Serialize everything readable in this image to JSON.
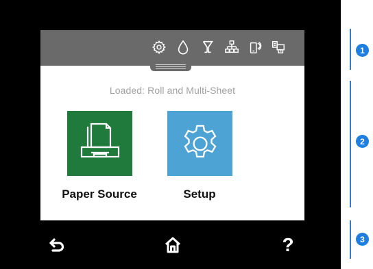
{
  "status_bar": {
    "icons": [
      "settings-icon",
      "ink-drop-icon",
      "wifi-direct-icon",
      "network-icon",
      "mobile-print-icon",
      "printer-info-icon"
    ]
  },
  "screen": {
    "loaded_text": "Loaded: Roll and Multi-Sheet"
  },
  "apps": [
    {
      "label": "Paper Source",
      "icon": "paper-source-icon",
      "color": "#1f7a3c"
    },
    {
      "label": "Setup",
      "icon": "gear-icon",
      "color": "#4da3d3"
    }
  ],
  "nav": {
    "back_icon": "back-icon",
    "home_icon": "home-icon",
    "help_label": "?"
  },
  "callouts": [
    "1",
    "2",
    "3"
  ],
  "colors": {
    "status_bar": "#6a6a6a",
    "callout_blue": "#1f7fe0",
    "device_frame": "#000000"
  }
}
